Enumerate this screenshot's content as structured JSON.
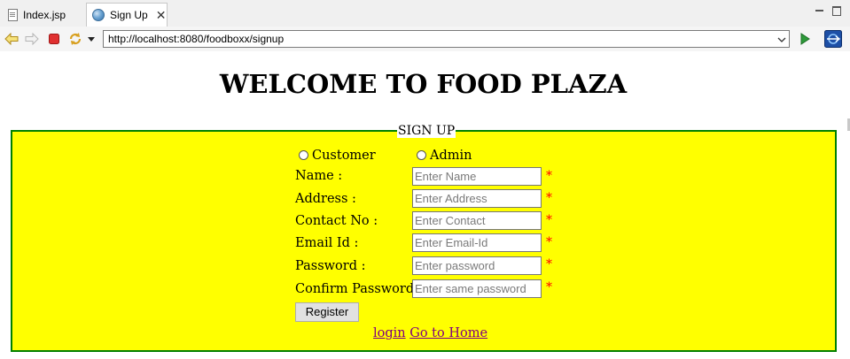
{
  "tabs": [
    {
      "label": "Index.jsp",
      "icon": "jsp-file-icon"
    },
    {
      "label": "Sign Up",
      "icon": "globe-icon"
    }
  ],
  "address_bar": {
    "url": "http://localhost:8080/foodboxx/signup"
  },
  "page": {
    "heading": "WELCOME TO FOOD PLAZA",
    "fieldset_legend": "SIGN UP",
    "roles": [
      "Customer",
      "Admin"
    ],
    "fields": [
      {
        "label": "Name :",
        "placeholder": "Enter Name"
      },
      {
        "label": "Address :",
        "placeholder": "Enter Address"
      },
      {
        "label": "Contact No :",
        "placeholder": "Enter Contact"
      },
      {
        "label": "Email Id :",
        "placeholder": "Enter Email-Id"
      },
      {
        "label": "Password :",
        "placeholder": "Enter password"
      },
      {
        "label": "Confirm Password :",
        "placeholder": "Enter same password"
      }
    ],
    "required_mark": "*",
    "register_label": "Register",
    "links": {
      "login": "login",
      "home": "Go to Home"
    }
  },
  "colors": {
    "form_background": "#ffff00",
    "form_border": "#008000",
    "required": "#ff0000",
    "link": "#800080"
  }
}
